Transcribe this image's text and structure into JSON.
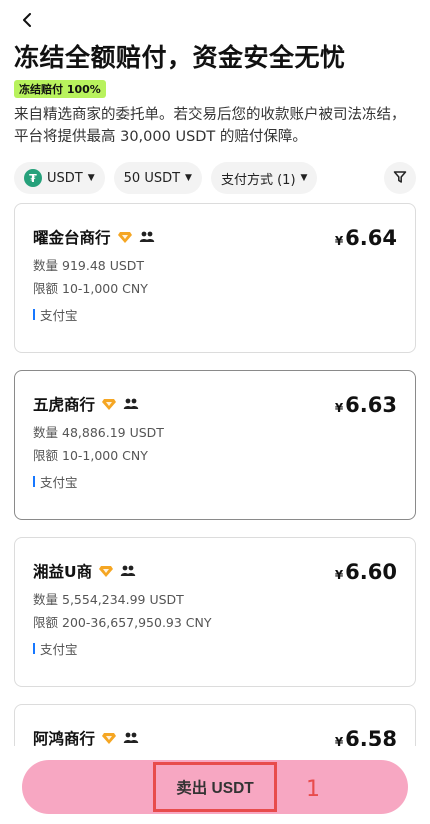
{
  "header": {
    "title": "冻结全额赔付，资金安全无忧",
    "badge": "冻结赔付 100%",
    "description": "来自精选商家的委托单。若交易后您的收款账户被司法冻结，平台将提供最高 30,000 USDT 的赔付保障。"
  },
  "filters": {
    "coin": "USDT",
    "amount": "50 USDT",
    "payment": "支付方式 (1)"
  },
  "labels": {
    "quantity": "数量",
    "limit": "限额",
    "currency_symbol": "¥"
  },
  "merchants": [
    {
      "name": "曜金台商行",
      "price": "6.64",
      "quantity": "919.48 USDT",
      "limit": "10-1,000 CNY",
      "payment": "支付宝"
    },
    {
      "name": "五虎商行",
      "price": "6.63",
      "quantity": "48,886.19 USDT",
      "limit": "10-1,000 CNY",
      "payment": "支付宝"
    },
    {
      "name": "湘益U商",
      "price": "6.60",
      "quantity": "5,554,234.99 USDT",
      "limit": "200-36,657,950.93 CNY",
      "payment": "支付宝"
    },
    {
      "name": "阿鸿商行",
      "price": "6.58",
      "quantity": "",
      "limit": "",
      "payment": ""
    }
  ],
  "action": {
    "sell_label": "卖出 USDT",
    "annotation": "1"
  },
  "colors": {
    "badge": "#b8f25d",
    "tether": "#26a17b",
    "diamond": "#f5a623",
    "bottom_bar": "#f7a7c2",
    "highlight": "#e84c4c",
    "pay_bar": "#1677ff"
  },
  "icons": [
    "back-icon",
    "tether-icon",
    "caret-down-icon",
    "filter-icon",
    "diamond-icon",
    "people-icon"
  ]
}
